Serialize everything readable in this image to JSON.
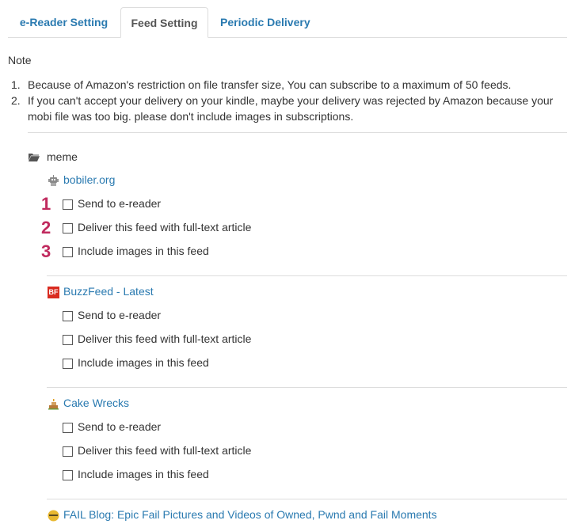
{
  "tabs": [
    {
      "label": "e-Reader Setting"
    },
    {
      "label": "Feed Setting",
      "active": true
    },
    {
      "label": "Periodic Delivery"
    }
  ],
  "note": {
    "heading": "Note",
    "items": [
      {
        "num": "1.",
        "text": "Because of Amazon's restriction on file transfer size, You can subscribe to a maximum of 50 feeds."
      },
      {
        "num": "2.",
        "text": "If you can't accept your delivery on your kindle, maybe your delivery was rejected by Amazon because your mobi file was too big. please don't include images in subscriptions."
      }
    ]
  },
  "folder": {
    "label": "meme",
    "icon": "folder-icon"
  },
  "markers": [
    "1",
    "2",
    "3"
  ],
  "options": {
    "send": "Send to e-reader",
    "fulltext": "Deliver this feed with full-text article",
    "images": "Include images in this feed"
  },
  "feeds": [
    {
      "title": "bobiler.org",
      "icon": "robot-icon"
    },
    {
      "title": "BuzzFeed - Latest",
      "icon": "buzzfeed-icon",
      "icon_text": "BF"
    },
    {
      "title": "Cake Wrecks",
      "icon": "cake-icon"
    },
    {
      "title": "FAIL Blog: Epic Fail Pictures and Videos of Owned, Pwnd and Fail Moments",
      "icon": "fail-blog-icon"
    }
  ],
  "colors": {
    "link": "#2a7ab0",
    "marker": "#c02a5e",
    "divider": "#dddddd"
  }
}
